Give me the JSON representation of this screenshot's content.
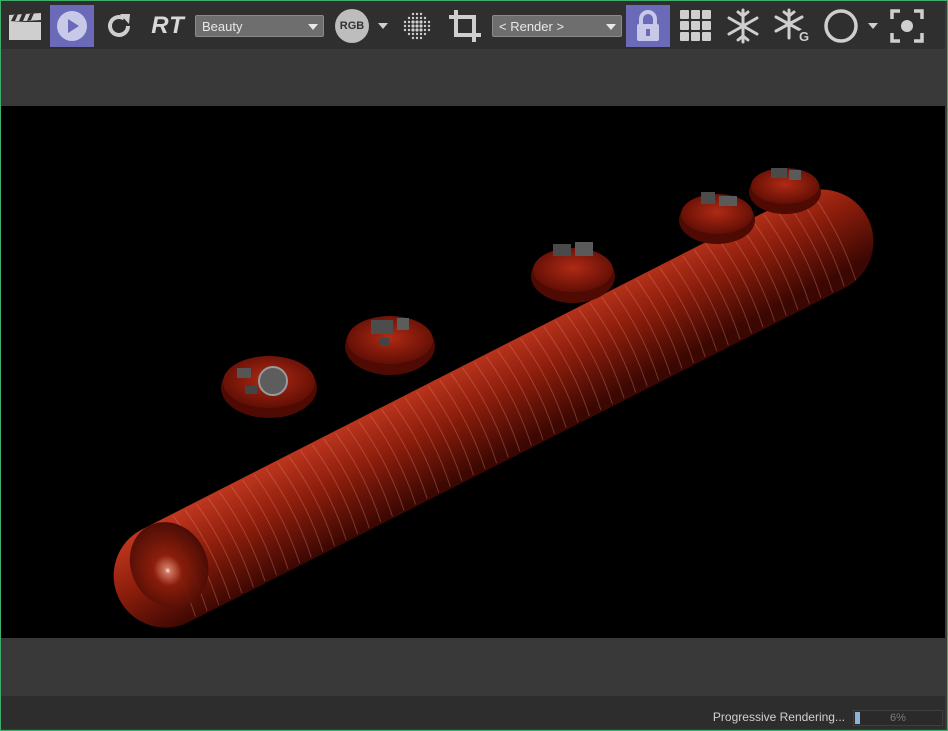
{
  "toolbar": {
    "pass_dropdown": {
      "value": "Beauty"
    },
    "rt_label": "RT",
    "channel_badge": "RGB",
    "render_dropdown": {
      "value": "< Render >"
    },
    "icons": [
      "clapperboard-icon",
      "play-icon",
      "refresh-icon",
      "rt-icon",
      "rgb-icon",
      "dot-grid-icon",
      "crop-icon",
      "lock-icon",
      "grid-icon",
      "snowflake-icon",
      "snowflake-g-icon",
      "circle-icon",
      "focus-icon"
    ],
    "accent_color": "#6a6ab8"
  },
  "render": {
    "description_visible": false
  },
  "status": {
    "text": "Progressive Rendering...",
    "progress_percent": 6,
    "progress_label": "6%"
  }
}
